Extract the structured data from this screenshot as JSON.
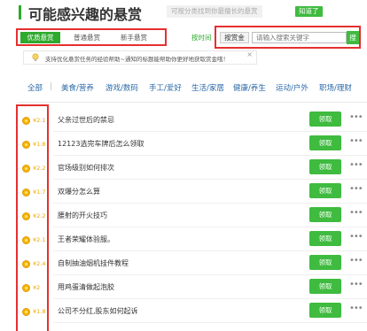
{
  "header": {
    "title": "可能感兴趣的悬赏",
    "hint": "可按分类找到你最擅长的悬赏",
    "know_button": "知道了"
  },
  "tabs": [
    {
      "label": "优质悬赏",
      "active": true
    },
    {
      "label": "普通悬赏",
      "active": false
    },
    {
      "label": "新手悬赏",
      "active": false
    }
  ],
  "sort_by_time": "按时间",
  "search": {
    "scope_label": "按赏金",
    "placeholder": "请输入搜索关键字",
    "button": "搜"
  },
  "notice": {
    "text": "支持优化悬赏任务的经验帮助~通知的标题能帮助你更好地获取赏金哦！",
    "close": "×"
  },
  "categories": [
    "全部",
    "美食/营养",
    "游戏/数码",
    "手工/爱好",
    "生活/家居",
    "健康/养生",
    "运动/户外",
    "职场/理财"
  ],
  "rows": [
    {
      "amount": "¥2.1",
      "question": "父亲过世后的禁忌",
      "action": "领取",
      "more": "•••"
    },
    {
      "amount": "¥1.8",
      "question": "12123选完车牌后怎么领取",
      "action": "领取",
      "more": "•••"
    },
    {
      "amount": "¥2.2",
      "question": "官场级别如何排次",
      "action": "领取",
      "more": "•••"
    },
    {
      "amount": "¥1.7",
      "question": "双爆分怎么算",
      "action": "领取",
      "more": "•••"
    },
    {
      "amount": "¥2.2",
      "question": "腰射的开火技巧",
      "action": "领取",
      "more": "•••"
    },
    {
      "amount": "¥2.1",
      "question": "王者荣耀体验服。",
      "action": "领取",
      "more": "•••"
    },
    {
      "amount": "¥2.4",
      "question": "自制抽油烟机挂件教程",
      "action": "领取",
      "more": "•••"
    },
    {
      "amount": "¥2",
      "question": "用鸡蛋清做起泡胶",
      "action": "领取",
      "more": "•••"
    },
    {
      "amount": "¥1.8",
      "question": "公司不分红,股东如何起诉",
      "action": "领取",
      "more": "•••"
    }
  ],
  "colors": {
    "brand_green": "#3fbb3f",
    "highlight_red": "#e53030",
    "coin_gold": "#f5b400",
    "category_blue": "#2a6aa8"
  },
  "icons": {
    "notice": "lightbulb-icon",
    "coin": "coin-icon",
    "more": "more-dots-icon"
  }
}
